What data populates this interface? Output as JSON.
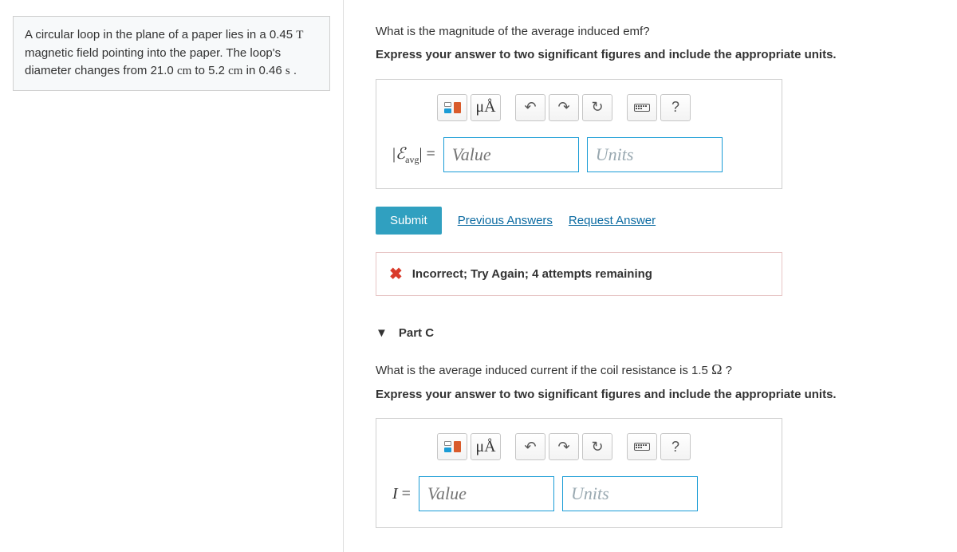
{
  "problem": {
    "text_a": "A circular loop in the plane of a paper lies in a 0.45 ",
    "var_T": "T",
    "text_b": " magnetic field pointing into the paper. The loop's diameter changes from 21.0 ",
    "unit_cm1": "cm",
    "text_c": " to 5.2 ",
    "unit_cm2": "cm",
    "text_d": " in 0.46 ",
    "unit_s": "s",
    "text_e": " ."
  },
  "partB": {
    "question": "What is the magnitude of the average induced emf?",
    "instruction": "Express your answer to two significant figures and include the appropriate units.",
    "units_btn": "μÅ",
    "help": "?",
    "label_a": "|",
    "label_eps": "ℰ",
    "label_sub": "avg",
    "label_b": "|",
    "label_eq": " = ",
    "value_ph": "Value",
    "units_ph": "Units",
    "submit": "Submit",
    "prev": "Previous Answers",
    "req": "Request Answer",
    "feedback": "Incorrect; Try Again; 4 attempts remaining"
  },
  "partC": {
    "title": "Part C",
    "question_a": "What is the average induced current if the coil resistance is 1.5 ",
    "ohm": "Ω",
    "question_b": " ?",
    "instruction": "Express your answer to two significant figures and include the appropriate units.",
    "units_btn": "μÅ",
    "help": "?",
    "label": "I",
    "label_eq": " = ",
    "value_ph": "Value",
    "units_ph": "Units"
  }
}
